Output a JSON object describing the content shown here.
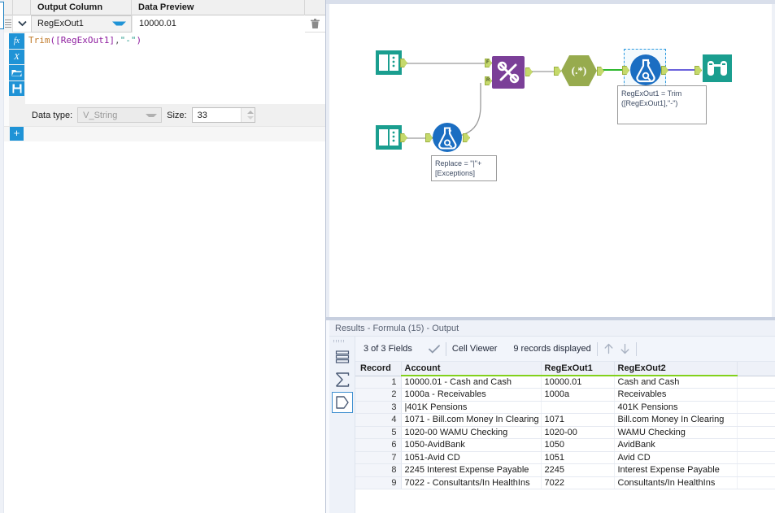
{
  "config_panel": {
    "columns": [
      "Output Column",
      "Data Preview"
    ],
    "row": {
      "output_column": "RegExOut1",
      "data_preview": "10000.01"
    },
    "formula": {
      "full_text": "Trim([RegExOut1],\"-\")",
      "tokens": {
        "fn": "Trim",
        "open": "(",
        "field": "[RegExOut1]",
        "comma": ",",
        "string": "\"-\"",
        "close": ")"
      }
    },
    "data_type_label": "Data type:",
    "data_type_value": "V_String",
    "size_label": "Size:",
    "size_value": "33",
    "icons": {
      "fx": "fx-icon",
      "variable": "variable-x-icon",
      "open": "open-folder-icon",
      "save": "save-disk-icon",
      "delete": "trash-icon",
      "add": "add-row-icon"
    }
  },
  "canvas": {
    "annotations": [
      {
        "id": "formula-annotation",
        "line1": "RegExOut1 = Trim",
        "line2": "([RegExOut1],\"-\")"
      },
      {
        "id": "find-replace-annotation",
        "line1": "Replace = \"|\"+",
        "line2": "[Exceptions]"
      }
    ],
    "anchor_labels": {
      "find": "F",
      "replace": "R"
    },
    "regex_glyph": "(.*)",
    "tools": [
      {
        "name": "input-data-tool-top",
        "type": "input"
      },
      {
        "name": "input-data-tool-bottom",
        "type": "input"
      },
      {
        "name": "find-replace-tool",
        "type": "findreplace"
      },
      {
        "name": "formula-tool-lower",
        "type": "formula"
      },
      {
        "name": "regex-tool",
        "type": "regex"
      },
      {
        "name": "formula-tool-selected",
        "type": "formula"
      },
      {
        "name": "browse-tool",
        "type": "browse"
      }
    ],
    "colors": {
      "input_teal": "#1a9e8f",
      "findreplace_purple": "#7b3f98",
      "regex_olive": "#97ab4e",
      "formula_blue": "#1b6ec2",
      "browse_teal": "#1a9e8f",
      "anchor_green": "#c5d96b",
      "wire_gray": "#9a9a9a",
      "wire_green": "#2eb82e",
      "wire_blue": "#3a2fd0"
    }
  },
  "results": {
    "title": "Results - Formula (15) - Output",
    "toolbar": {
      "fields": "3 of 3 Fields",
      "checkmark": "check-icon",
      "viewer": "Cell Viewer",
      "records": "9 records displayed",
      "up": "arrow-up-icon",
      "down": "arrow-down-icon"
    },
    "rail": {
      "data_view": "data-view-icon",
      "profile": "profile-sigma-icon",
      "metadata": "metadata-tag-icon"
    },
    "table": {
      "headers": [
        "Record",
        "Account",
        "RegExOut1",
        "RegExOut2"
      ],
      "rows": [
        {
          "record": "1",
          "account": "10000.01 - Cash and Cash",
          "r1": "10000.01",
          "r2": "Cash and Cash"
        },
        {
          "record": "2",
          "account": "1000a - Receivables",
          "r1": "1000a",
          "r2": "Receivables"
        },
        {
          "record": "3",
          "account": "|401K Pensions",
          "r1": "",
          "r2": "401K Pensions"
        },
        {
          "record": "4",
          "account": "1071 - Bill.com Money In Clearing",
          "r1": "1071",
          "r2": "Bill.com Money In Clearing"
        },
        {
          "record": "5",
          "account": "1020-00 WAMU Checking",
          "r1": "1020-00",
          "r2": "WAMU Checking"
        },
        {
          "record": "6",
          "account": "1050-AvidBank",
          "r1": "1050",
          "r2": "AvidBank"
        },
        {
          "record": "7",
          "account": "1051-Avid CD",
          "r1": "1051",
          "r2": "Avid CD"
        },
        {
          "record": "8",
          "account": "2245 Interest Expense Payable",
          "r1": "2245",
          "r2": "Interest Expense Payable"
        },
        {
          "record": "9",
          "account": "7022 - Consultants/In HealthIns",
          "r1": "7022",
          "r2": "Consultants/In HealthIns"
        }
      ]
    }
  }
}
